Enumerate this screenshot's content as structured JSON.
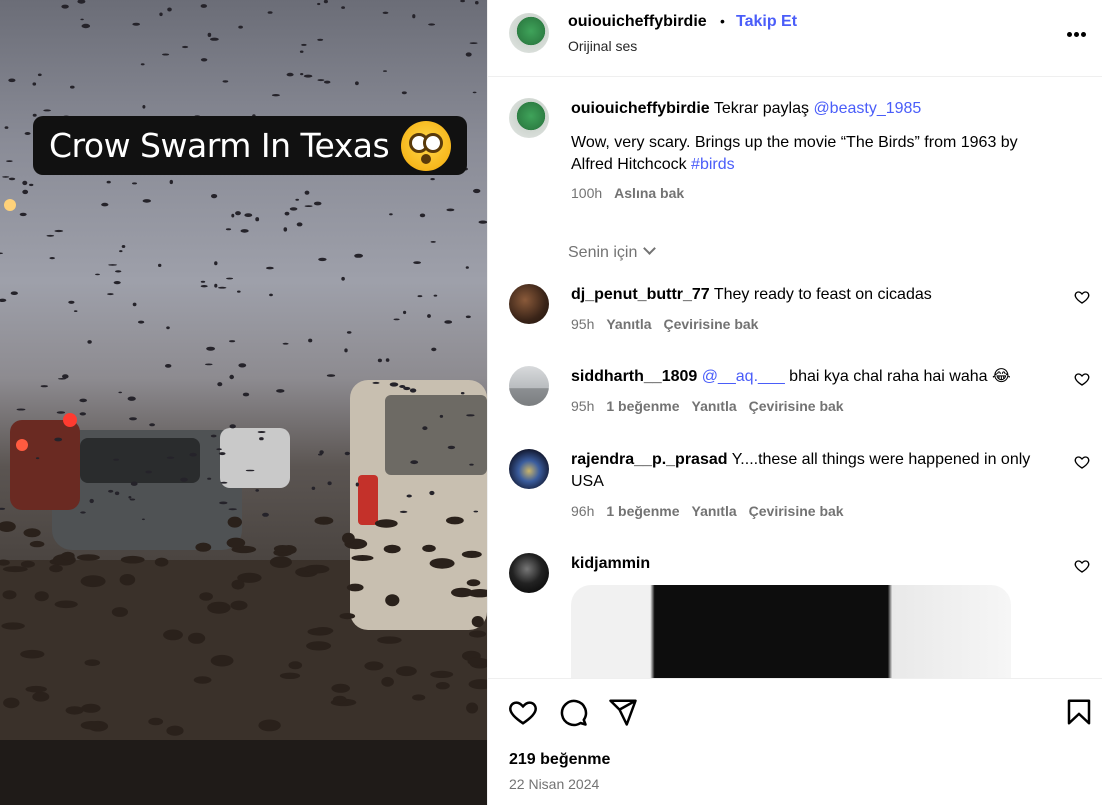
{
  "media": {
    "overlay_caption": "Crow Swarm In Texas",
    "overlay_emoji": "flushed-face"
  },
  "header": {
    "username": "ouiouicheffybirdie",
    "separator": "•",
    "follow_label": "Takip Et",
    "audio_label": "Orijinal ses",
    "more_icon": "more-horizontal-icon"
  },
  "caption": {
    "username": "ouiouicheffybirdie",
    "repost_text": "Tekrar paylaş",
    "mention": "@beasty_1985",
    "body": "Wow, very scary. Brings up the movie “The Birds” from 1963 by Alfred Hitchcock",
    "hashtag": "#birds",
    "time": "100h",
    "see_original": "Aslına bak"
  },
  "sort": {
    "label": "Senin için"
  },
  "comments": [
    {
      "username": "dj_penut_buttr_77",
      "text": "They ready to feast on cicadas",
      "time": "95h",
      "likes": "",
      "reply": "Yanıtla",
      "translate": "Çevirisine bak"
    },
    {
      "username": "siddharth__1809",
      "mention": "@__aq.___",
      "text": "bhai kya chal raha hai waha 😂",
      "time": "95h",
      "likes": "1 beğenme",
      "reply": "Yanıtla",
      "translate": "Çevirisine bak"
    },
    {
      "username": "rajendra__p._prasad",
      "text": "Y....these all things were happened in only USA",
      "time": "96h",
      "likes": "1 beğenme",
      "reply": "Yanıtla",
      "translate": "Çevirisine bak"
    },
    {
      "username": "kidjammin",
      "text": "",
      "has_image": true
    }
  ],
  "actions": {
    "icons": [
      "heart-icon",
      "comment-icon",
      "share-icon",
      "bookmark-icon"
    ],
    "likes_count": "219 beğenme",
    "date": "22 Nisan 2024"
  },
  "colors": {
    "link": "#4a5df9",
    "secondary_text": "#737373",
    "border": "#efefef"
  }
}
